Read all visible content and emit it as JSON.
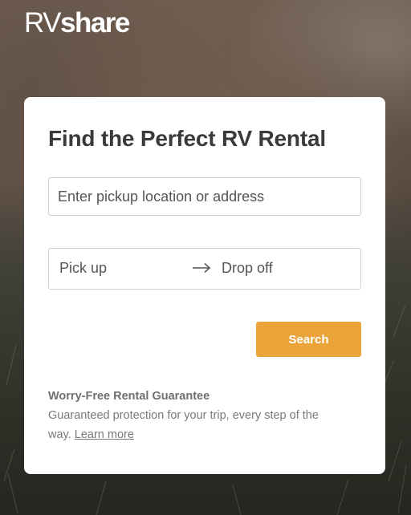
{
  "brand": {
    "logo_rv": "RV",
    "logo_share": "share"
  },
  "search_card": {
    "title": "Find the Perfect RV Rental",
    "location_placeholder": "Enter pickup location or address",
    "pickup_label": "Pick up",
    "dropoff_label": "Drop off",
    "arrow_icon": "arrow-right-icon",
    "search_label": "Search"
  },
  "guarantee": {
    "title": "Worry-Free Rental Guarantee",
    "text": "Guaranteed protection for your trip, every step of the way.",
    "link_text": "Learn more"
  },
  "colors": {
    "accent": "#eba43a",
    "card_bg": "#ffffff"
  }
}
